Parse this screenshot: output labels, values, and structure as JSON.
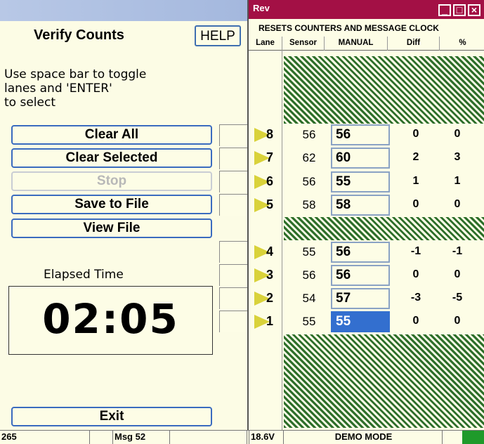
{
  "left": {
    "title": "Verify Counts",
    "help_label": "HELP",
    "instructions": "Use space bar to toggle\nlanes and 'ENTER'\nto select",
    "buttons": {
      "clear_all": "Clear All",
      "clear_selected": "Clear Selected",
      "stop": "Stop",
      "save_to_file": "Save to File",
      "view_file": "View File",
      "exit": "Exit"
    },
    "elapsed_label": "Elapsed Time",
    "elapsed_value": "02:05"
  },
  "status": {
    "left_value": "265",
    "msg": "Msg 52",
    "voltage": "18.6V",
    "mode": "DEMO MODE"
  },
  "rev": {
    "title": "Rev",
    "controls": [
      "_",
      "□",
      "×"
    ],
    "subtitle": "RESETS COUNTERS AND MESSAGE CLOCK",
    "headers": [
      "Lane",
      "Sensor",
      "MANUAL",
      "Diff",
      "%"
    ],
    "lanes": [
      {
        "lane": "8",
        "sensor": "56",
        "manual": "56",
        "diff": "0",
        "pct": "0"
      },
      {
        "lane": "7",
        "sensor": "62",
        "manual": "60",
        "diff": "2",
        "pct": "3"
      },
      {
        "lane": "6",
        "sensor": "56",
        "manual": "55",
        "diff": "1",
        "pct": "1"
      },
      {
        "lane": "5",
        "sensor": "58",
        "manual": "58",
        "diff": "0",
        "pct": "0"
      },
      {
        "lane": "4",
        "sensor": "55",
        "manual": "56",
        "diff": "-1",
        "pct": "-1"
      },
      {
        "lane": "3",
        "sensor": "56",
        "manual": "56",
        "diff": "0",
        "pct": "0"
      },
      {
        "lane": "2",
        "sensor": "54",
        "manual": "57",
        "diff": "-3",
        "pct": "-5"
      },
      {
        "lane": "1",
        "sensor": "55",
        "manual": "55",
        "diff": "0",
        "pct": "0"
      }
    ]
  },
  "colors": {
    "titlebar": "#a31045",
    "hatch": "#2d6e2a",
    "arrow": "#d9d23a",
    "selected": "#336fcf"
  }
}
